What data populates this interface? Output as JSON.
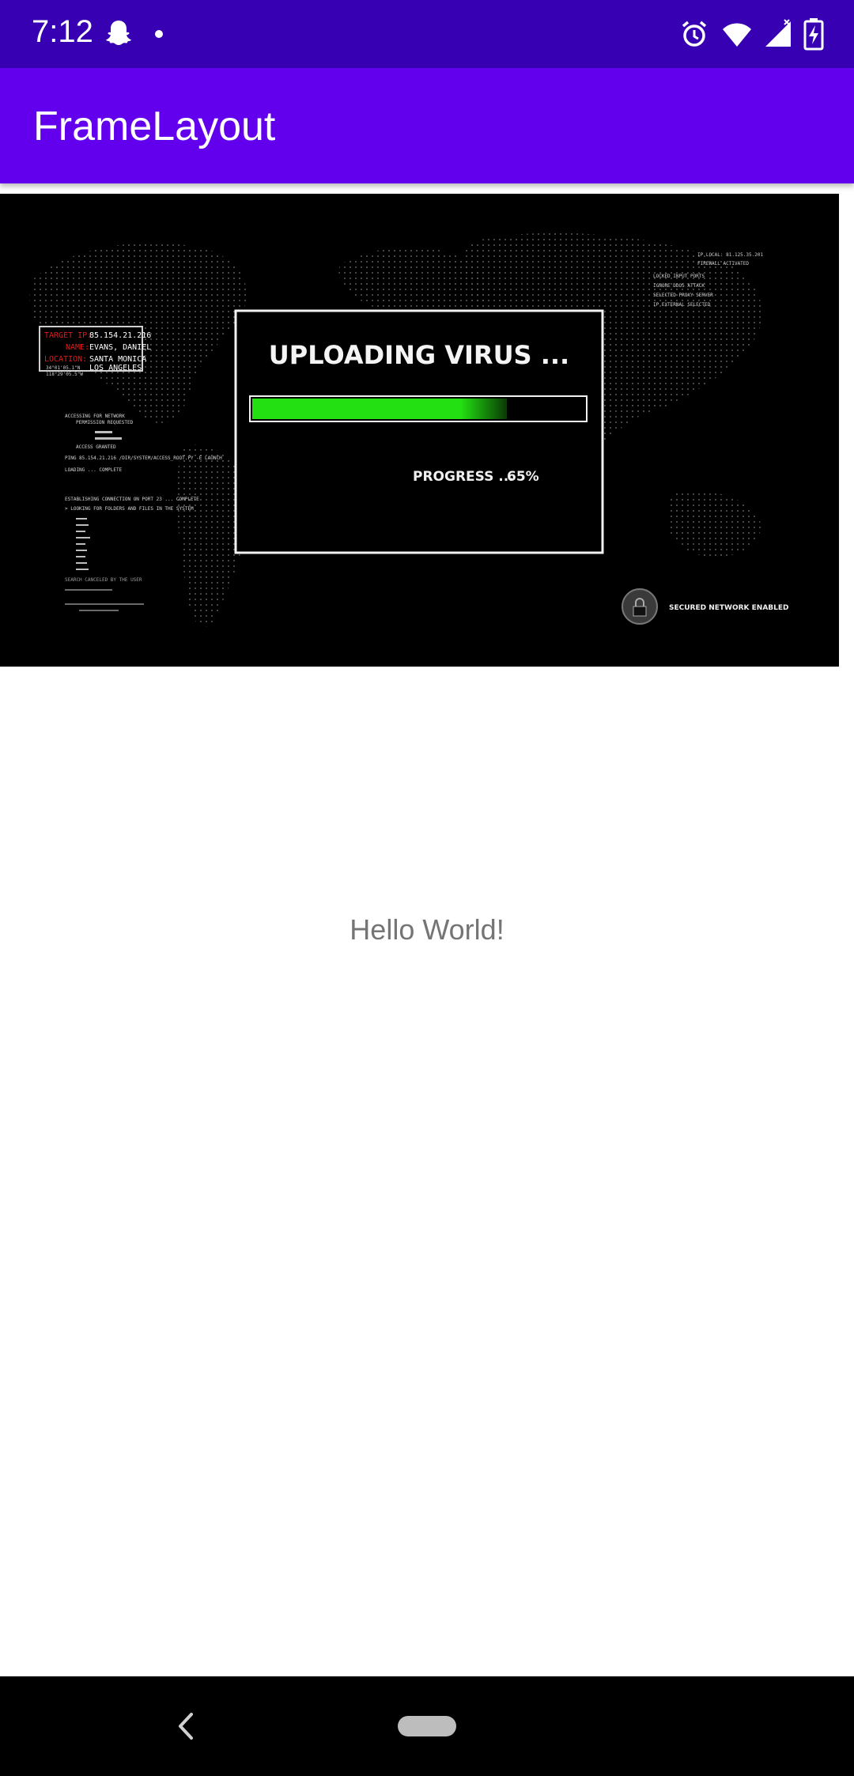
{
  "status_bar": {
    "time": "7:12",
    "background": "#3700b3",
    "left_icons": [
      "snapchat-icon",
      "dot-icon"
    ],
    "right_icons": [
      "alarm-icon",
      "wifi-icon",
      "signal-icon",
      "battery-charging-icon"
    ]
  },
  "app_bar": {
    "title": "FrameLayout",
    "background": "#6200ee"
  },
  "banner": {
    "target_ip_label": "TARGET IP:",
    "target_ip": "85.154.21.216",
    "name_label": "NAME:",
    "name": "EVANS, DANIEL",
    "location_label": "LOCATION:",
    "location_1": "SANTA MONICA",
    "location_2": "LOS ANGELES",
    "coord_1": "34°01'05.1\"N",
    "coord_2": "118°29'05.5\"W",
    "heading": "UPLOADING VIRUS ...",
    "progress_label": "PROGRESS ...",
    "progress_value": "65%",
    "progress_fraction": 0.65,
    "progress_color": "#22e011",
    "log_lines": [
      "ACCESSING FOR NETWORK",
      "PERMISSION REQUESTED",
      "ACCESS GRANTED",
      "PING 85.154.21.216 /DIR/SYSTEM/ACCESS_ROOT.PY -E LAUNCH",
      "LOADING ... COMPLETE",
      "ESTABLISHING CONNECTION ON PORT 23 ... COMPLETE",
      "> LOOKING FOR FOLDERS AND FILES IN THE SYSTEM",
      "SEARCH CANCELED BY THE USER"
    ],
    "right_lines": [
      "IP LOCAL: 81.125.35.201",
      "FIREWALL ACTIVATED",
      "LOCKED INPUT PORTS",
      "IGNORE DDOS ATTACK",
      "SELECTED PROXY SERVER",
      "IP EXTERNAL SELECTED"
    ],
    "secured_label": "SECURED NETWORK ENABLED"
  },
  "main": {
    "hello_text": "Hello World!"
  },
  "nav_bar": {
    "icons": [
      "back-icon",
      "home-pill-icon"
    ]
  }
}
